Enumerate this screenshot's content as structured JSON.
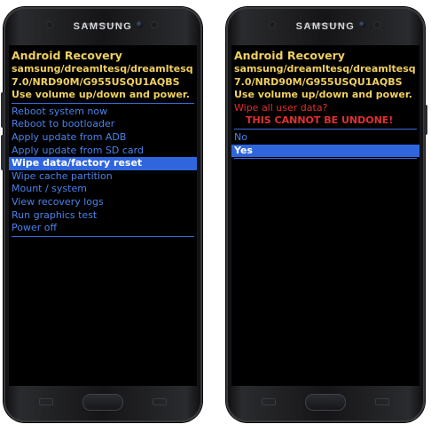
{
  "phones": [
    {
      "brand": "SAMSUNG",
      "title": "Android Recovery",
      "info": [
        "samsung/dreamltesq/dreamltesq",
        "7.0/NRD90M/G955USQU1AQBS",
        "Use volume up/down and power."
      ],
      "menu": [
        "Reboot system now",
        "Reboot to bootloader",
        "Apply update from ADB",
        "Apply update from SD card",
        "Wipe data/factory reset",
        "Wipe cache partition",
        "Mount / system",
        "View recovery logs",
        "Run graphics test",
        "Power off"
      ],
      "selected_item": "Wipe data/factory reset"
    },
    {
      "brand": "SAMSUNG",
      "title": "Android Recovery",
      "info": [
        "samsung/dreamltesq/dreamltesq",
        "7.0/NRD90M/G955USQU1AQBS",
        "Use volume up/down and power."
      ],
      "warning": [
        "Wipe all user data?",
        "THIS CANNOT BE UNDONE!"
      ],
      "menu": [
        "No",
        "Yes"
      ],
      "selected_item": "Yes"
    }
  ],
  "colors": {
    "title_text": "#f0d060",
    "menu_text": "#4a82ea",
    "highlight": "#2f66de",
    "warning_text": "#e23030"
  }
}
